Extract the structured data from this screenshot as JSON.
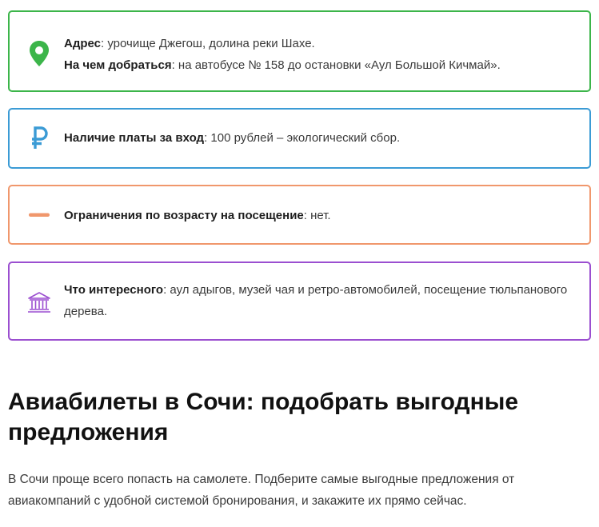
{
  "cards": {
    "address": {
      "icon": "map-pin-icon",
      "color": "#3cb54a",
      "address_label": "Адрес",
      "address_value": ": урочище Джегош, долина реки Шахе.",
      "route_label": "На чем добраться",
      "route_value": ": на автобусе № 158 до остановки «Аул Большой Кичмай»."
    },
    "payment": {
      "icon": "ruble-icon",
      "color": "#3b9bd5",
      "label": "Наличие платы за вход",
      "value": ": 100 рублей – экологический сбор."
    },
    "age": {
      "icon": "minus-icon",
      "color": "#f0976c",
      "label": "Ограничения по возрасту на посещение",
      "value": ": нет."
    },
    "interest": {
      "icon": "museum-icon",
      "color": "#9b4fd0",
      "label": "Что интересного",
      "value": ": аул адыгов, музей чая и ретро-автомобилей, посещение тюльпанового дерева."
    }
  },
  "section": {
    "heading": "Авиабилеты в Сочи: подобрать выгодные предложения",
    "paragraph": "В Сочи проще всего попасть на самолете. Подберите самые выгодные предложения от авиакомпаний с удобной системой бронирования, и закажите их прямо сейчас."
  }
}
